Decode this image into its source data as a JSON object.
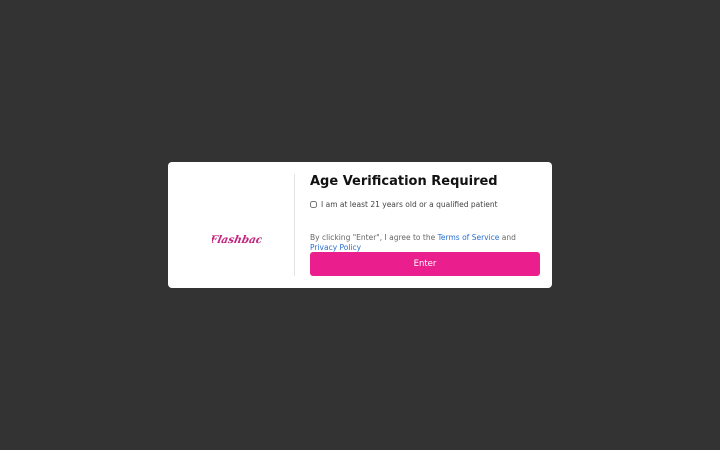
{
  "brand": {
    "logo_text": "Flashback",
    "logo_color": "#c2267f"
  },
  "modal": {
    "title": "Age Verification Required",
    "checkbox_label": "I am at least 21 years old or a qualified patient",
    "checkbox_checked": false,
    "consent_prefix": "By clicking \"Enter\", I agree to the ",
    "terms_link": "Terms of Service",
    "consent_and": " and ",
    "privacy_link": "Privacy Policy",
    "enter_label": "Enter"
  },
  "colors": {
    "backdrop": "#333333",
    "accent": "#ea1e8c",
    "link": "#2a6fd0"
  }
}
